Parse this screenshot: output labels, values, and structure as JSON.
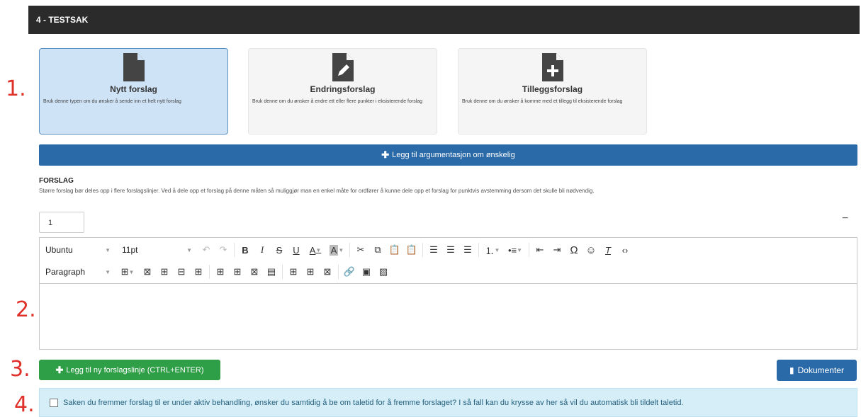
{
  "header": {
    "title": "4 - TESTSAK"
  },
  "annotations": [
    "1.",
    "2.",
    "3.",
    "4."
  ],
  "proposal_types": [
    {
      "title": "Nytt forslag",
      "description": "Bruk denne typen om du ønsker å sende inn et helt nytt forslag",
      "icon": "file-icon",
      "selected": true
    },
    {
      "title": "Endringsforslag",
      "description": "Bruk denne om du ønsker å endre ett eller flere punkter i eksisterende forslag",
      "icon": "file-edit-icon",
      "selected": false
    },
    {
      "title": "Tilleggsforslag",
      "description": "Bruk denne om du ønsker å komme med et tillegg til eksisterende forslag",
      "icon": "file-plus-icon",
      "selected": false
    }
  ],
  "argument_button": "Legg til argumentasjon om ønskelig",
  "forslag": {
    "title": "FORSLAG",
    "description": "Større forslag bør deles opp i flere forslagslinjer. Ved å dele opp et forslag på denne måten så muliggjør man en enkel måte for ordfører å kunne dele opp et forslag for punktvis avstemming dersom det skulle bli nødvendig.",
    "line_number": "1"
  },
  "editor": {
    "font_family": "Ubuntu",
    "font_size": "11pt",
    "block_format": "Paragraph",
    "content": ""
  },
  "buttons": {
    "add_line": "Legg til ny forslagslinje (CTRL+ENTER)",
    "documents": "Dokumenter"
  },
  "speaking_time": {
    "checked": false,
    "label": "Saken du fremmer forslag til er under aktiv behandling, ønsker du samtidig å be om taletid for å fremme forslaget? I så fall kan du krysse av her så vil du automatisk bli tildelt taletid."
  },
  "colors": {
    "header": "#2b2b2b",
    "primary": "#2a6aa8",
    "success": "#2e9e47",
    "info": "#d6eef7",
    "annotation": "#e0302a"
  }
}
